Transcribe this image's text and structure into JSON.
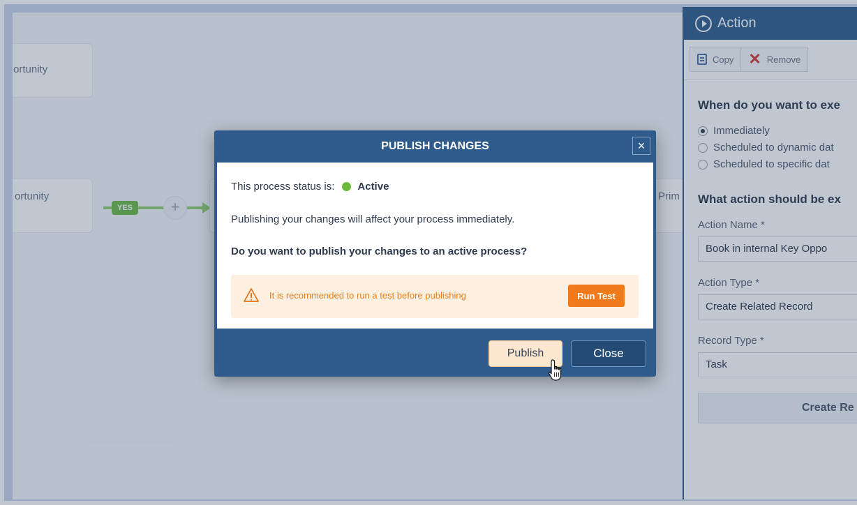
{
  "canvas": {
    "node_1_label": "ortunity",
    "node_2_label": "ortunity",
    "node_4_label": "Prim",
    "yes_label": "YES",
    "plus_symbol": "+"
  },
  "side_panel": {
    "title": "Action",
    "toolbar": {
      "copy_label": "Copy",
      "remove_label": "Remove"
    },
    "when_title": "When do you want to exe",
    "timing_options": [
      {
        "label": "Immediately",
        "selected": true
      },
      {
        "label": "Scheduled to dynamic dat",
        "selected": false
      },
      {
        "label": "Scheduled to specific dat",
        "selected": false
      }
    ],
    "what_title": "What action should be ex",
    "fields": [
      {
        "label": "Action Name *",
        "value": "Book in internal Key Oppo"
      },
      {
        "label": "Action Type *",
        "value": "Create Related Record"
      },
      {
        "label": "Record Type *",
        "value": "Task"
      }
    ],
    "create_button_label": "Create Re"
  },
  "modal": {
    "title": "PUBLISH CHANGES",
    "close_symbol": "×",
    "status_prefix": "This process status is:",
    "status_value": "Active",
    "status_color": "#6cbb3c",
    "info_text": "Publishing your changes will affect your process immediately.",
    "question": "Do you want to publish your changes to an active process?",
    "warning_text": "It is recommended to run a test before publishing",
    "warning_icon": "warning-triangle-icon",
    "run_test_label": "Run Test",
    "publish_label": "Publish",
    "close_label": "Close"
  },
  "colors": {
    "primary": "#2e5b8c",
    "warning": "#f07a1a",
    "warning_bg": "#fdf0e1",
    "success": "#6cbb3c"
  }
}
